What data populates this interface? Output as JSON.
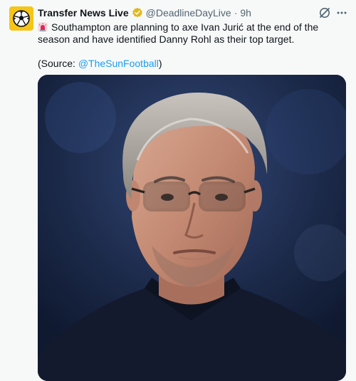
{
  "tweet": {
    "author_name": "Transfer News Live",
    "handle": "@DeadlineDayLive",
    "separator": "·",
    "time": "9h",
    "line1": "Southampton are planning to axe Ivan Jurić at the end of the season and have identified Danny Rohl as their top target.",
    "source_open": "(Source: ",
    "source_link": "@TheSunFootball",
    "source_close": ")",
    "icons": {
      "avatar": "football-logo-icon",
      "verified": "verified-badge-icon",
      "siren": "rotating-light-icon",
      "grok": "grok-icon",
      "more": "more-options-icon"
    },
    "colors": {
      "link": "#1d9bf0",
      "verified_badge": "#e2b719",
      "avatar_bg": "#f5c518"
    }
  }
}
